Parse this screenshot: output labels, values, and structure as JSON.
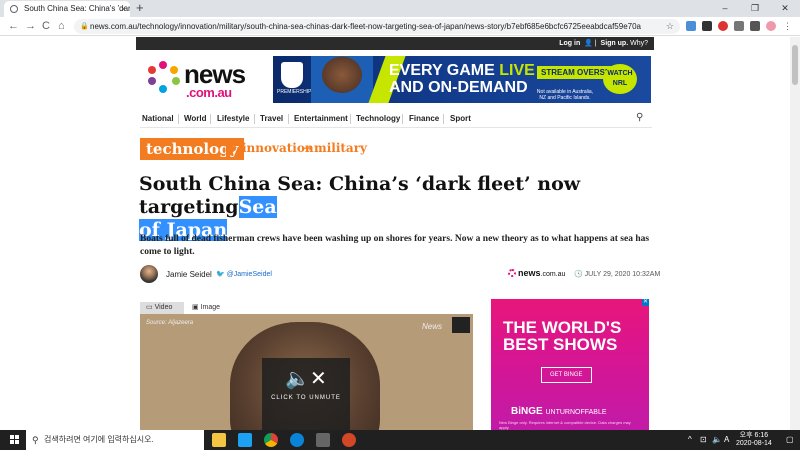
{
  "browser": {
    "tab_title": "South China Sea: China's 'dark",
    "tab_close": "×",
    "new_tab": "+",
    "window_minimize": "–",
    "window_maximize": "❐",
    "window_close": "✕",
    "back": "←",
    "forward": "→",
    "reload": "C",
    "home": "⌂",
    "url": "news.com.au/technology/innovation/military/south-china-sea-chinas-dark-fleet-now-targeting-sea-of-japan/news-story/b7ebf685e6bcfc6725eeabdcaf59e70a"
  },
  "topbar": {
    "login": "Log in",
    "signup": "Sign up.",
    "why": "Why?"
  },
  "logo": {
    "word": "news",
    "sub": ".com.au"
  },
  "banner": {
    "line1_pre": "EVERY GAME",
    "line1_live": "LIVE",
    "line2": "AND ON-DEMAND",
    "stream": "STREAM OVERSEAS",
    "fine": "Not available in Australia, NZ and Pacific Islands.",
    "watch": "WATCH NRL",
    "premiership": "PREMIERSHIP"
  },
  "nav": {
    "items": [
      "National",
      "World",
      "Lifestyle",
      "Travel",
      "Entertainment",
      "Technology",
      "Finance",
      "Sport"
    ]
  },
  "breadcrumb": {
    "section": "technology",
    "sub1": "innovation",
    "arrow": "→",
    "sub2": "military"
  },
  "article": {
    "headline_main": "South China Sea: China’s ‘dark fleet’ now targeting",
    "headline_selected_1": "Sea",
    "headline_selected_2": "of Japan",
    "standfirst": "Boats full of dead fisherman crews have been washing up on shores for years. Now a new theory as to what happens at sea has come to light.",
    "author": "Jamie Seidel",
    "twitter": "@JamieSeidel",
    "source_logo": "news",
    "source_suffix": ".com.au",
    "date": "JULY 29, 2020 10:32AM"
  },
  "media": {
    "tab_video": "Video",
    "tab_image": "Image",
    "source": "Source: Aljazeera",
    "watermark": "News",
    "unmute_label": "CLICK TO UNMUTE"
  },
  "ad": {
    "headline": "THE WORLD'S BEST SHOWS",
    "button": "GET BINGE",
    "brand": "BiNGE",
    "brand_tag": "UNTURNOFFABLE",
    "fine": "New Binge only. Requires internet & compatible device. Data charges may apply."
  },
  "taskbar": {
    "search_placeholder": "검색하려면 여기에 입력하십시오.",
    "time_line1": "오후 6:16",
    "time_line2": "2020-08-14",
    "tray_arrow": "^",
    "ime": "A"
  },
  "colors": {
    "accent_orange": "#f47c20",
    "brand_pink": "#e2117a",
    "selection_blue": "#3390ff",
    "nrl_lime": "#c6e600"
  }
}
